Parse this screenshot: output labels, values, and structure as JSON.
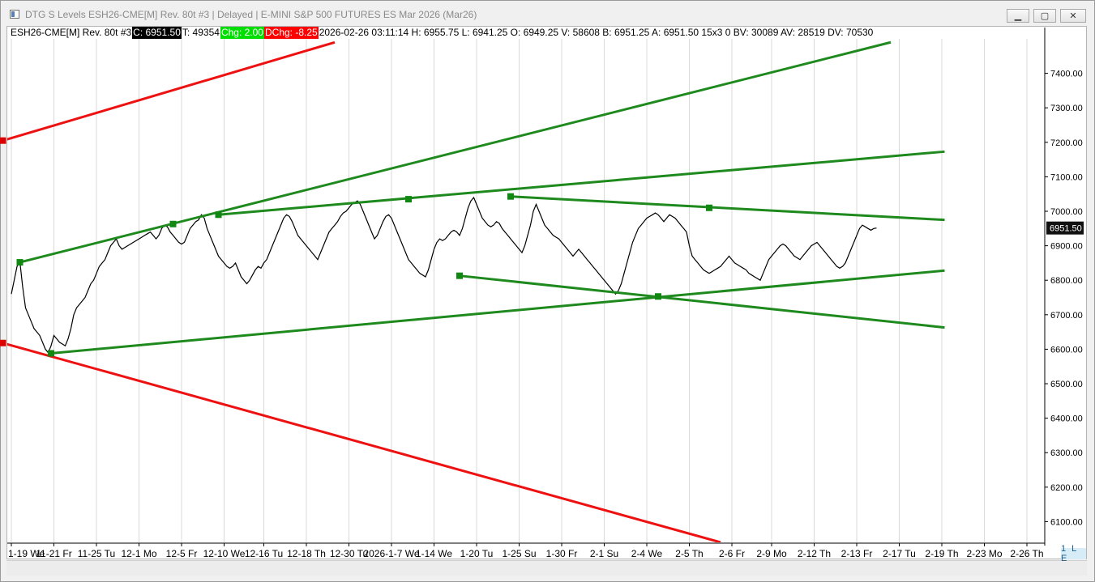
{
  "window": {
    "title": "DTG S Levels ESH26-CME[M]  Rev. 80t #3 | Delayed | E-MINI S&P 500 FUTURES ES Mar 2026 (Mar26)",
    "minimize": "▁",
    "restore": "▢",
    "close": "✕"
  },
  "info": {
    "symbol": "ESH26-CME[M]  Rev. 80t #3",
    "close": "C: 6951.50",
    "trades": "T: 49354",
    "chg": "Chg: 2.00",
    "dchg": "DChg: -8.25",
    "details": "2026-02-26 03:11:14 H: 6955.75 L: 6941.25 O: 6949.25 V: 58608 B: 6951.25 A: 6951.50 15x3 0 BV: 30089 AV: 28519 DV: 70530"
  },
  "status": {
    "panel_label": "1 L E"
  },
  "colors": {
    "green_line": "#1e8a1e",
    "red_line": "#ee1111",
    "price_series": "#000000",
    "grid": "#d9d9d9"
  },
  "chart_data": {
    "type": "line",
    "title": "",
    "xlabel": "",
    "ylabel": "",
    "ylim": [
      6040,
      7500
    ],
    "y_ticks": [
      "7400.00",
      "7300.00",
      "7200.00",
      "7100.00",
      "7000.00",
      "6900.00",
      "6800.00",
      "6700.00",
      "6600.00",
      "6500.00",
      "6400.00",
      "6300.00",
      "6200.00",
      "6100.00"
    ],
    "y_tick_values": [
      7400,
      7300,
      7200,
      7100,
      7000,
      6900,
      6800,
      6700,
      6600,
      6500,
      6400,
      6300,
      6200,
      6100
    ],
    "x_tick_labels": [
      "1-19 We",
      "11-21 Fr",
      "11-25 Tu",
      "12-1 Mo",
      "12-5 Fr",
      "12-10 We",
      "12-16 Tu",
      "12-18 Th",
      "12-30 Tu",
      "2026-1-7 We",
      "1-14 We",
      "1-20 Tu",
      "1-25 Su",
      "1-30 Fr",
      "2-1 Su",
      "2-4 We",
      "2-5 Th",
      "2-6 Fr",
      "2-9 Mo",
      "2-12 Th",
      "2-13 Fr",
      "2-17 Tu",
      "2-19 Th",
      "2-23 Mo",
      "2-26 Th"
    ],
    "x_tick_positions": [
      0,
      15,
      30,
      45,
      60,
      75,
      89,
      104,
      119,
      134,
      149,
      164,
      179,
      194,
      209,
      224,
      239,
      254,
      268,
      283,
      298,
      313,
      328,
      343,
      358
    ],
    "bar_count": 365,
    "last_price": "6951.50",
    "last_price_value": 6951.5,
    "series": [
      {
        "values": [
          6760,
          6800,
          6840,
          6855,
          6780,
          6720,
          6700,
          6680,
          6660,
          6650,
          6640,
          6620,
          6600,
          6590,
          6610,
          6640,
          6630,
          6620,
          6615,
          6610,
          6630,
          6660,
          6700,
          6720,
          6730,
          6740,
          6750,
          6770,
          6790,
          6800,
          6820,
          6840,
          6850,
          6860,
          6880,
          6900,
          6910,
          6920,
          6900,
          6890,
          6895,
          6900,
          6905,
          6910,
          6915,
          6920,
          6925,
          6930,
          6935,
          6940,
          6930,
          6920,
          6930,
          6950,
          6960,
          6955,
          6940,
          6930,
          6920,
          6910,
          6905,
          6910,
          6930,
          6950,
          6960,
          6970,
          6975,
          6990,
          6980,
          6950,
          6930,
          6910,
          6890,
          6870,
          6860,
          6850,
          6840,
          6835,
          6840,
          6850,
          6830,
          6810,
          6800,
          6790,
          6800,
          6815,
          6830,
          6840,
          6835,
          6850,
          6860,
          6880,
          6900,
          6920,
          6940,
          6960,
          6980,
          6990,
          6985,
          6970,
          6950,
          6930,
          6920,
          6910,
          6900,
          6890,
          6880,
          6870,
          6860,
          6880,
          6900,
          6920,
          6940,
          6950,
          6960,
          6970,
          6985,
          6995,
          7000,
          7010,
          7020,
          7025,
          7030,
          7020,
          7000,
          6980,
          6960,
          6940,
          6920,
          6930,
          6950,
          6970,
          6985,
          6990,
          6980,
          6960,
          6940,
          6920,
          6900,
          6880,
          6860,
          6850,
          6840,
          6830,
          6820,
          6815,
          6810,
          6830,
          6860,
          6890,
          6910,
          6920,
          6915,
          6920,
          6930,
          6940,
          6945,
          6940,
          6930,
          6950,
          6980,
          7010,
          7030,
          7040,
          7020,
          7000,
          6980,
          6970,
          6960,
          6955,
          6960,
          6970,
          6965,
          6950,
          6940,
          6930,
          6920,
          6910,
          6900,
          6890,
          6880,
          6900,
          6930,
          6960,
          7000,
          7020,
          7000,
          6980,
          6960,
          6950,
          6940,
          6930,
          6925,
          6920,
          6910,
          6900,
          6890,
          6880,
          6870,
          6880,
          6890,
          6880,
          6870,
          6860,
          6850,
          6840,
          6830,
          6820,
          6810,
          6800,
          6790,
          6780,
          6770,
          6760,
          6770,
          6790,
          6820,
          6850,
          6880,
          6910,
          6930,
          6950,
          6960,
          6970,
          6980,
          6985,
          6990,
          6995,
          6990,
          6980,
          6970,
          6980,
          6990,
          6985,
          6980,
          6970,
          6960,
          6950,
          6940,
          6900,
          6870,
          6860,
          6850,
          6840,
          6830,
          6825,
          6820,
          6825,
          6830,
          6835,
          6840,
          6850,
          6860,
          6870,
          6860,
          6850,
          6845,
          6840,
          6835,
          6830,
          6820,
          6815,
          6810,
          6805,
          6800,
          6820,
          6840,
          6860,
          6870,
          6880,
          6890,
          6900,
          6905,
          6900,
          6890,
          6880,
          6870,
          6865,
          6860,
          6870,
          6880,
          6890,
          6900,
          6905,
          6910,
          6900,
          6890,
          6880,
          6870,
          6860,
          6850,
          6840,
          6835,
          6840,
          6850,
          6870,
          6890,
          6910,
          6930,
          6950,
          6960,
          6955,
          6950,
          6945,
          6950,
          6951.5
        ]
      }
    ],
    "trendlines": [
      {
        "color": "red",
        "x1": -3,
        "y1": 7205,
        "x2": 114,
        "y2": 7490
      },
      {
        "color": "red",
        "x1": -3,
        "y1": 6618,
        "x2": 250,
        "y2": 6040
      },
      {
        "color": "green",
        "x1": 3,
        "y1": 6852,
        "x2": 310,
        "y2": 7490
      },
      {
        "color": "green",
        "x1": 14,
        "y1": 6588,
        "x2": 329,
        "y2": 6828
      },
      {
        "color": "green",
        "x1": 73,
        "y1": 6990,
        "x2": 329,
        "y2": 7173
      },
      {
        "color": "green",
        "x1": 176,
        "y1": 7043,
        "x2": 329,
        "y2": 6975
      },
      {
        "color": "green",
        "x1": 158,
        "y1": 6813,
        "x2": 329,
        "y2": 6663
      }
    ],
    "anchor_points": [
      {
        "color": "red",
        "x": -3,
        "y": 7205
      },
      {
        "color": "red",
        "x": -3,
        "y": 6618
      },
      {
        "color": "green",
        "x": 3,
        "y": 6852
      },
      {
        "color": "green",
        "x": 14,
        "y": 6588
      },
      {
        "color": "green",
        "x": 57,
        "y": 6963
      },
      {
        "color": "green",
        "x": 73,
        "y": 6990
      },
      {
        "color": "green",
        "x": 140,
        "y": 7035
      },
      {
        "color": "green",
        "x": 176,
        "y": 7043
      },
      {
        "color": "green",
        "x": 158,
        "y": 6813
      },
      {
        "color": "green",
        "x": 228,
        "y": 6753
      },
      {
        "color": "green",
        "x": 246,
        "y": 7010
      }
    ]
  }
}
